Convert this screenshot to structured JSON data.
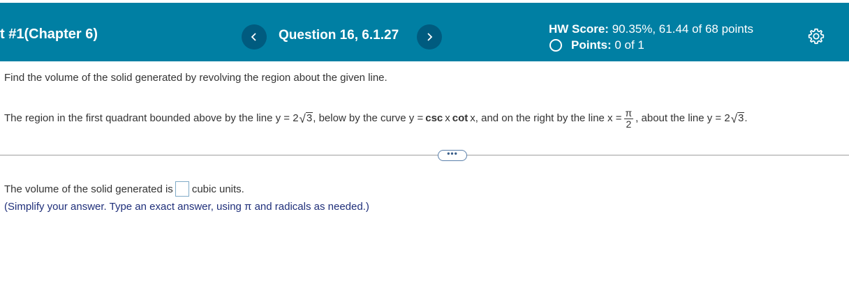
{
  "header": {
    "assignment_title": "t #1(Chapter 6)",
    "question_label": "Question 16, 6.1.27",
    "prev_icon": "chevron-left-icon",
    "next_icon": "chevron-right-icon",
    "hw_score_label": "HW Score:",
    "hw_score_value": "90.35%, 61.44 of 68 points",
    "points_label": "Points:",
    "points_value": "0 of 1",
    "settings_icon": "gear-icon",
    "bar_color": "#007fa3"
  },
  "question": {
    "prompt": "Find the volume of the solid generated by revolving the region about the given line.",
    "region_part1": "The region in the first quadrant bounded above by the line y = 2",
    "sqrt3_a": "3",
    "region_part2": ", below by the curve y =",
    "csc": "csc",
    "x1": "x",
    "cot": "cot",
    "x2": "x, and on the right by the line x =",
    "frac_num": "π",
    "frac_den": "2",
    "region_part3": ", about the line y = 2",
    "sqrt3_b": "3",
    "region_end": "."
  },
  "more_button": "•••",
  "answer": {
    "prefix": "The volume of the solid generated is",
    "input_value": "",
    "suffix": "cubic units.",
    "instructions": "(Simplify your answer. Type an exact answer, using π and radicals as needed.)"
  }
}
